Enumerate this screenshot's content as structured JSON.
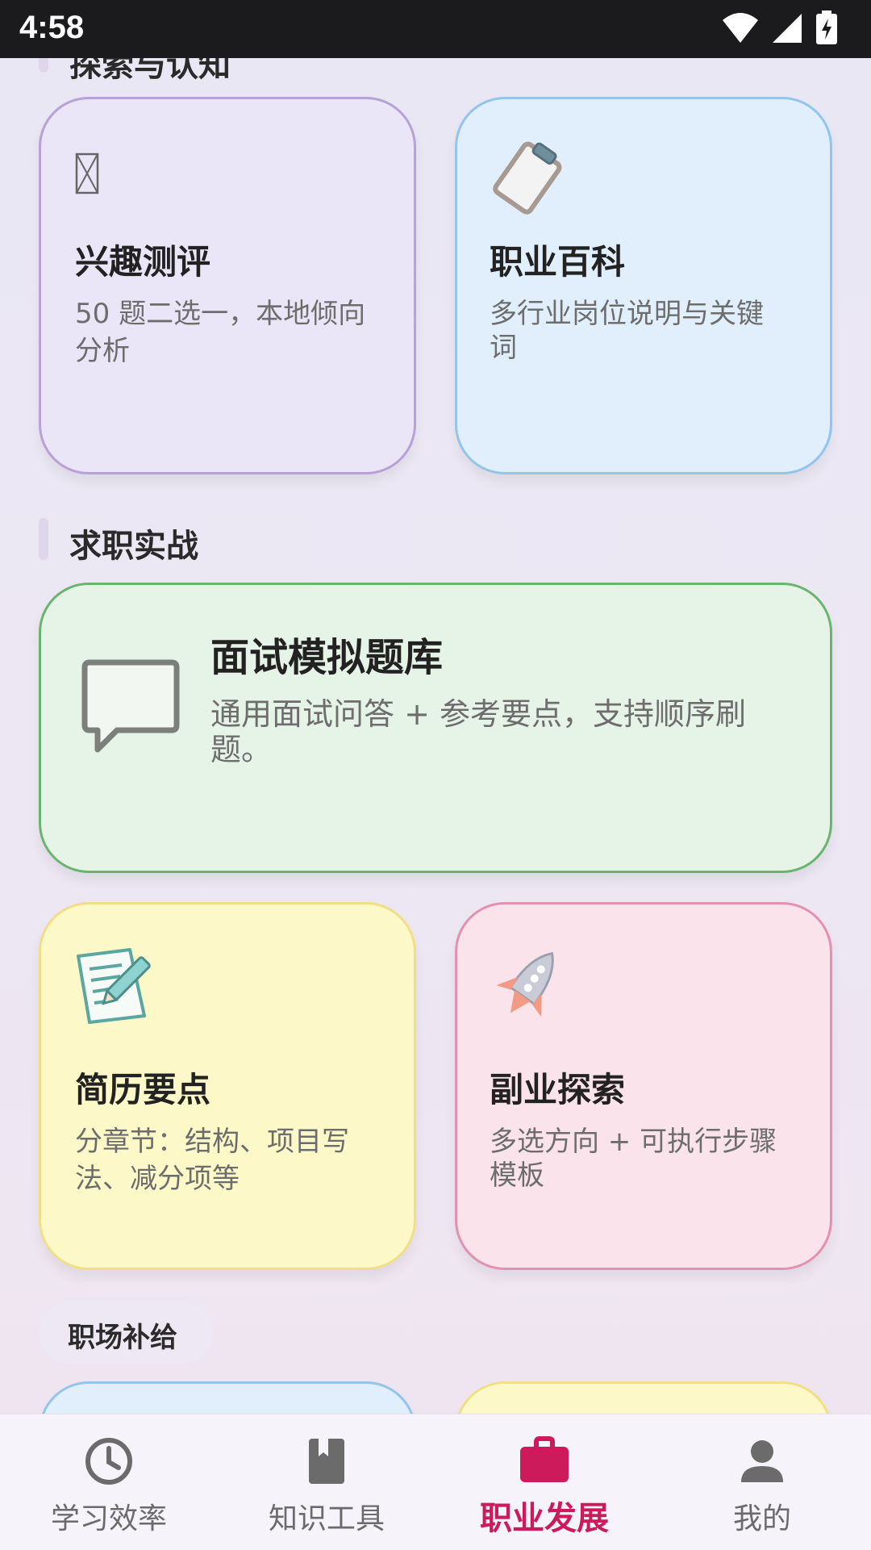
{
  "status": {
    "time": "4:58"
  },
  "sections": {
    "explore_title": "探索与认知",
    "practice_title": "求职实战",
    "supply_chip": "职场补给"
  },
  "cards": {
    "interest": {
      "title": "兴趣测评",
      "desc_line1": "50 题二选一，本地倾向",
      "desc_line2": "分析",
      "icon": "broken-image-icon"
    },
    "encyclopedia": {
      "title": "职业百科",
      "desc_line1": "多行业岗位说明与关键",
      "desc_line2": "词",
      "icon": "clipboard-icon"
    },
    "interview": {
      "title": "面试模拟题库",
      "desc_line1": "通用面试问答 + 参考要点，支持顺序刷",
      "desc_line2": "题。",
      "icon": "speech-bubble-icon"
    },
    "resume": {
      "title": "简历要点",
      "desc_line1": "分章节：结构、项目写",
      "desc_line2": "法、减分项等",
      "icon": "memo-pencil-icon"
    },
    "side_job": {
      "title": "副业探索",
      "desc_line1": "多选方向 + 可执行步骤",
      "desc_line2": "模板",
      "icon": "rocket-icon"
    }
  },
  "nav": [
    {
      "label": "学习效率",
      "icon": "clock-icon",
      "active": false
    },
    {
      "label": "知识工具",
      "icon": "book-icon",
      "active": false
    },
    {
      "label": "职业发展",
      "icon": "briefcase-icon",
      "active": true
    },
    {
      "label": "我的",
      "icon": "person-icon",
      "active": false
    }
  ],
  "colors": {
    "accent": "#cc1a5a",
    "purple_card": "#ebe6f7",
    "blue_card": "#e1effc",
    "green_card": "#e6f3e7",
    "yellow_card": "#fdf8c8",
    "pink_card": "#fbe3ec"
  }
}
